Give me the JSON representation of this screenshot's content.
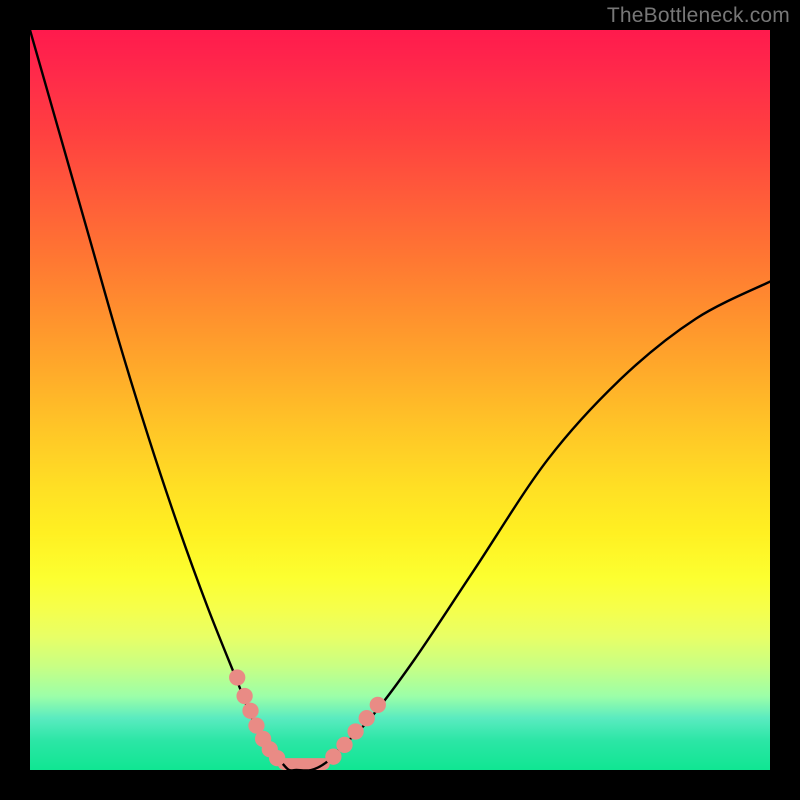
{
  "watermark": {
    "text": "TheBottleneck.com"
  },
  "chart_data": {
    "type": "line",
    "title": "",
    "xlabel": "",
    "ylabel": "",
    "xlim": [
      0,
      100
    ],
    "ylim": [
      0,
      100
    ],
    "series": [
      {
        "name": "bottleneck-curve",
        "color": "#000000",
        "x": [
          0,
          4,
          8,
          12,
          16,
          20,
          24,
          28,
          30,
          32,
          33,
          34,
          35,
          36,
          38,
          40,
          42,
          46,
          52,
          60,
          70,
          80,
          90,
          100
        ],
        "values": [
          100,
          86,
          72,
          58,
          45,
          33,
          22,
          12,
          7,
          4,
          2,
          1,
          0,
          0,
          0,
          1,
          3,
          7,
          15,
          27,
          42,
          53,
          61,
          66
        ]
      }
    ],
    "markers": {
      "name": "highlight-dots",
      "color": "#e98b85",
      "radius_pct": 1.1,
      "points": [
        {
          "x": 28.0,
          "y": 12.5
        },
        {
          "x": 29.0,
          "y": 10.0
        },
        {
          "x": 29.8,
          "y": 8.0
        },
        {
          "x": 30.6,
          "y": 6.0
        },
        {
          "x": 31.5,
          "y": 4.2
        },
        {
          "x": 32.4,
          "y": 2.8
        },
        {
          "x": 33.4,
          "y": 1.6
        },
        {
          "x": 41.0,
          "y": 1.8
        },
        {
          "x": 42.5,
          "y": 3.4
        },
        {
          "x": 44.0,
          "y": 5.2
        },
        {
          "x": 45.5,
          "y": 7.0
        },
        {
          "x": 47.0,
          "y": 8.8
        }
      ]
    },
    "baseline_bar": {
      "x0": 33.5,
      "x1": 40.5,
      "y": 0,
      "color": "#e98b85",
      "thickness_pct": 1.6
    }
  }
}
